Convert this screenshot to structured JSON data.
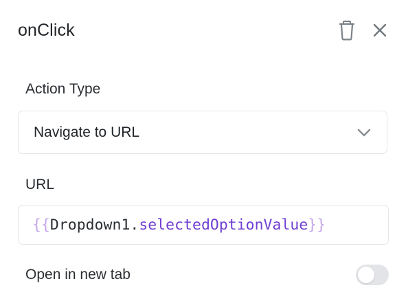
{
  "header": {
    "title": "onClick",
    "delete_icon": "trash-icon",
    "close_icon": "close-icon"
  },
  "action_type": {
    "label": "Action Type",
    "selected_value": "Navigate to URL",
    "chevron_icon": "chevron-down-icon"
  },
  "url": {
    "label": "URL",
    "open_brace": "{{",
    "object": "Dropdown1",
    "dot": ".",
    "property": "selectedOptionValue",
    "close_brace": "}}"
  },
  "new_tab": {
    "label": "Open in new tab",
    "enabled": false
  },
  "colors": {
    "brace": "#c4a6ec",
    "property": "#6f3fd1",
    "border": "#e3e5e8",
    "toggle_off": "#e2e4e7"
  }
}
